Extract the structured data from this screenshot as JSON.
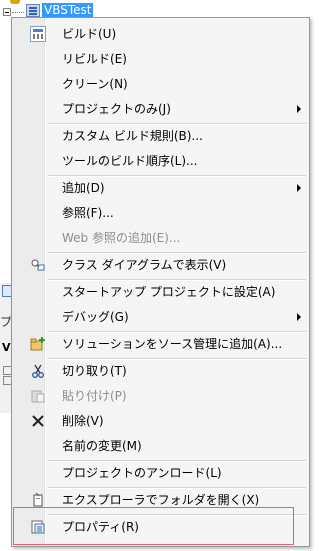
{
  "tree": {
    "project_name": "VBSTest"
  },
  "side_panel": {
    "tab_char": "プ",
    "label": "VE"
  },
  "menu": {
    "items": [
      {
        "label": "ビルド(U)",
        "icon": "build-icon"
      },
      {
        "label": "リビルド(E)"
      },
      {
        "label": "クリーン(N)"
      },
      {
        "label": "プロジェクトのみ(J)",
        "submenu": true
      },
      {
        "label": "カスタム ビルド規則(B)..."
      },
      {
        "label": "ツールのビルド順序(L)..."
      },
      {
        "label": "追加(D)",
        "submenu": true
      },
      {
        "label": "参照(F)..."
      },
      {
        "label": "Web 参照の追加(E)...",
        "disabled": true
      },
      {
        "label": "クラス ダイアグラムで表示(V)",
        "icon": "class-diagram-icon"
      },
      {
        "label": "スタートアップ プロジェクトに設定(A)"
      },
      {
        "label": "デバッグ(G)",
        "submenu": true
      },
      {
        "label": "ソリューションをソース管理に追加(A)...",
        "icon": "source-control-add-icon"
      },
      {
        "label": "切り取り(T)",
        "icon": "cut-icon"
      },
      {
        "label": "貼り付け(P)",
        "disabled": true,
        "icon": "paste-icon"
      },
      {
        "label": "削除(V)",
        "icon": "delete-icon"
      },
      {
        "label": "名前の変更(M)"
      },
      {
        "label": "プロジェクトのアンロード(L)"
      },
      {
        "label": "エクスプローラでフォルダを開く(X)",
        "icon": "open-folder-explorer-icon"
      },
      {
        "label": "プロパティ(R)",
        "icon": "properties-icon"
      }
    ]
  },
  "colors": {
    "selection": "#3399ff",
    "highlight_box": "#e06470",
    "disabled_text": "#8d8d8d"
  }
}
